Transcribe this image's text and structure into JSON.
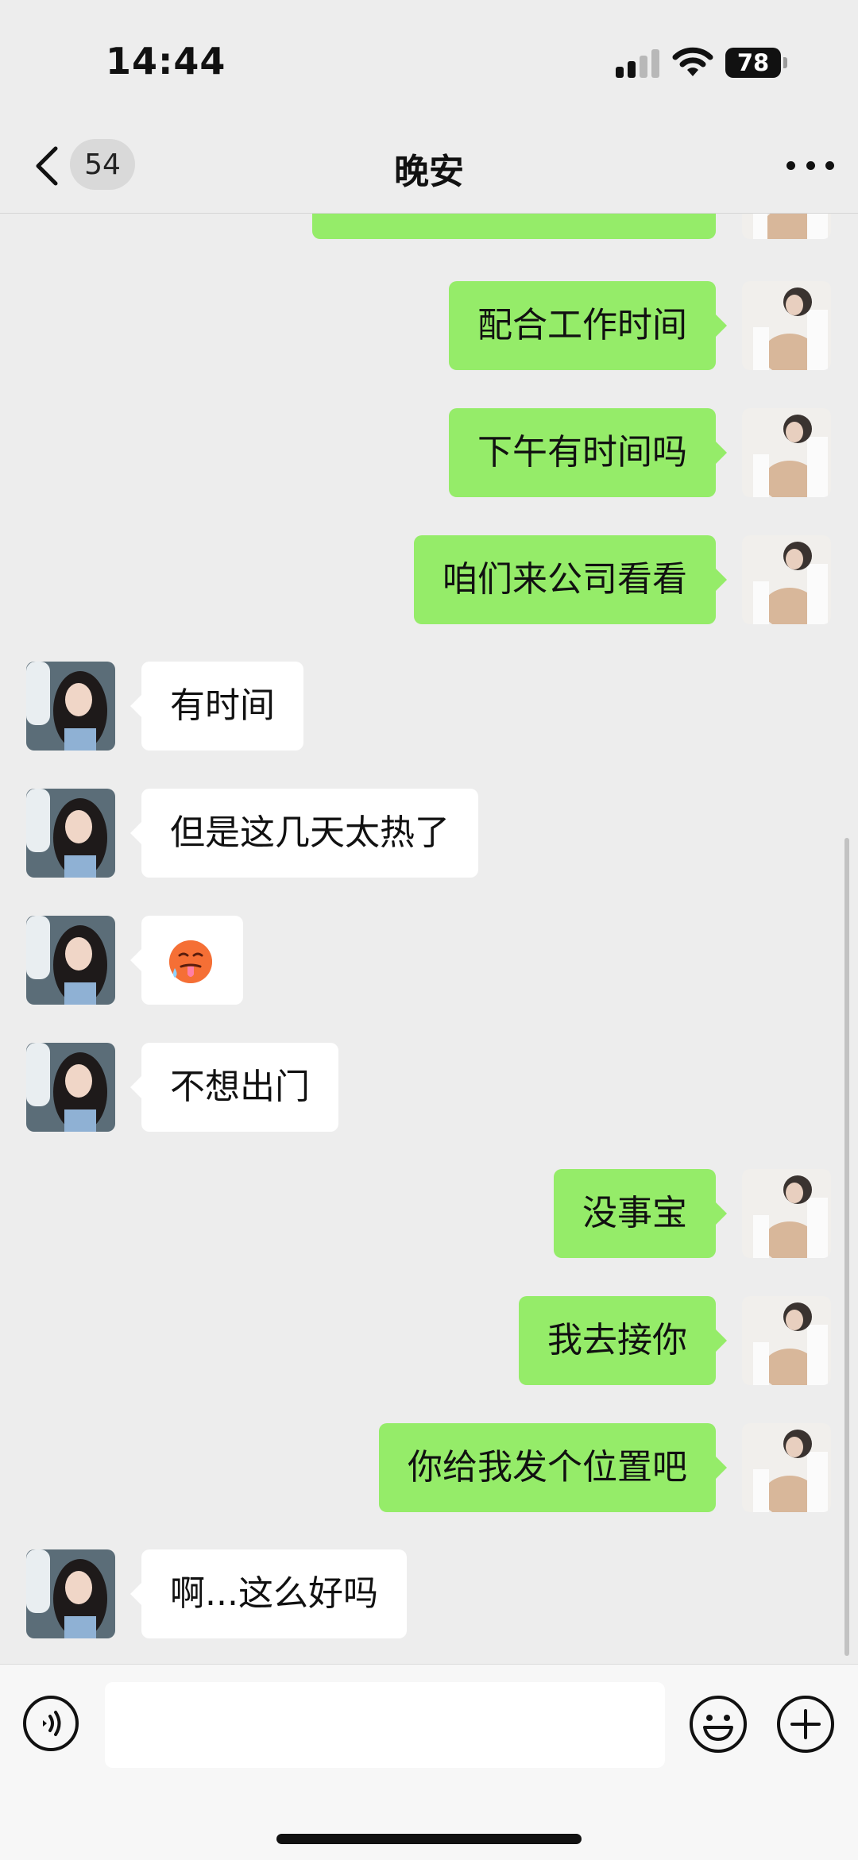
{
  "status_bar": {
    "time": "14:44",
    "battery": "78"
  },
  "nav": {
    "back_count": "54",
    "title": "晚安"
  },
  "messages": [
    {
      "side": "right",
      "text": "…"
    },
    {
      "side": "right",
      "text": "配合工作时间"
    },
    {
      "side": "right",
      "text": "下午有时间吗"
    },
    {
      "side": "right",
      "text": "咱们来公司看看"
    },
    {
      "side": "left",
      "text": "有时间"
    },
    {
      "side": "left",
      "text": "但是这几天太热了"
    },
    {
      "side": "left",
      "text": "🥵"
    },
    {
      "side": "left",
      "text": "不想出门"
    },
    {
      "side": "right",
      "text": "没事宝"
    },
    {
      "side": "right",
      "text": "我去接你"
    },
    {
      "side": "right",
      "text": "你给我发个位置吧"
    },
    {
      "side": "left",
      "text": "啊...这么好吗"
    }
  ],
  "input": {
    "value": "",
    "placeholder": ""
  },
  "icons": {
    "back": "chevron-left-icon",
    "more": "more-horizontal-icon",
    "voice": "voice-icon",
    "emoji": "emoji-icon",
    "plus": "plus-icon"
  },
  "colors": {
    "sent_bubble": "#95ec69",
    "received_bubble": "#ffffff",
    "background": "#ededed"
  }
}
